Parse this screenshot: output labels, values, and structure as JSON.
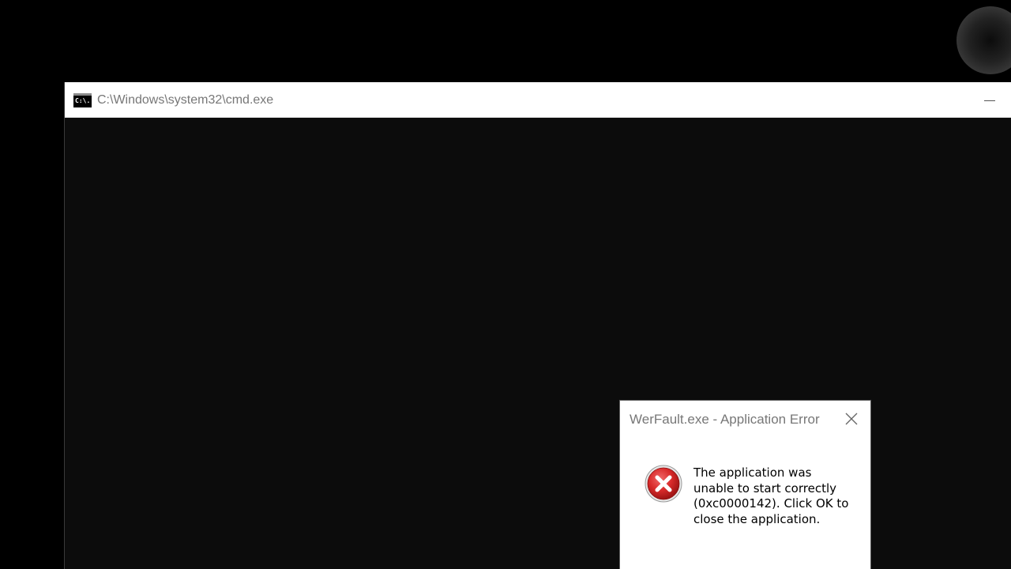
{
  "cmd_window": {
    "title": "C:\\Windows\\system32\\cmd.exe",
    "icon_label": "C:\\."
  },
  "error_dialog": {
    "title": "WerFault.exe - Application Error",
    "message": "The application was unable to start correctly (0xc0000142). Click OK to close the application."
  },
  "icons": {
    "cmd_icon": "command-prompt-icon",
    "minimize": "minimize-icon",
    "close": "close-icon",
    "error": "error-x-icon"
  },
  "colors": {
    "error_red": "#d92b2b",
    "console_bg": "#0c0c0c"
  }
}
